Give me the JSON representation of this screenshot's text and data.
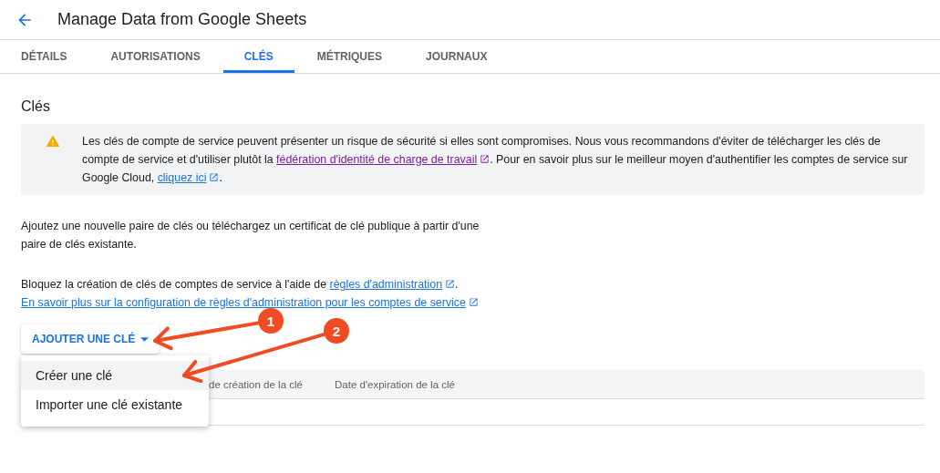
{
  "header": {
    "title": "Manage Data from Google Sheets"
  },
  "tabs": [
    {
      "label": "DÉTAILS",
      "selected": false
    },
    {
      "label": "AUTORISATIONS",
      "selected": false
    },
    {
      "label": "CLÉS",
      "selected": true
    },
    {
      "label": "MÉTRIQUES",
      "selected": false
    },
    {
      "label": "JOURNAUX",
      "selected": false
    }
  ],
  "section_title": "Clés",
  "warning": [
    {
      "kind": "text",
      "text": "Les clés de compte de service peuvent présenter un risque de sécurité si elles sont compromises. Nous vous recommandons d'éviter de télécharger les clés de compte de service et d'utiliser plutôt la "
    },
    {
      "kind": "link",
      "text": "fédération d'identité de charge de travail",
      "visited": true
    },
    {
      "kind": "text",
      "text": ". Pour en savoir plus sur le meilleur moyen d'authentifier les comptes de service sur Google Cloud, "
    },
    {
      "kind": "link",
      "text": "cliquez ici",
      "visited": false
    },
    {
      "kind": "text",
      "text": "."
    }
  ],
  "intro": "Ajoutez une nouvelle paire de clés ou téléchargez un certificat de clé publique à partir d'une paire de clés existante.",
  "policy": [
    {
      "kind": "text",
      "text": "Bloquez la création de clés de comptes de service à l'aide de "
    },
    {
      "kind": "link",
      "text": "règles d'administration",
      "visited": false
    },
    {
      "kind": "text",
      "text": ". "
    },
    {
      "kind": "link",
      "text": "En savoir plus sur la configuration de règles d'administration pour les comptes de service",
      "visited": false
    }
  ],
  "add_button": {
    "label": "AJOUTER UNE CLÉ"
  },
  "menu": [
    {
      "label": "Créer une clé",
      "selected": true
    },
    {
      "label": "Importer une clé existante",
      "selected": false
    }
  ],
  "table": {
    "columns": [
      "de création de la clé",
      "Date d'expiration de la clé"
    ]
  },
  "annotations": [
    {
      "label": "1"
    },
    {
      "label": "2"
    }
  ]
}
